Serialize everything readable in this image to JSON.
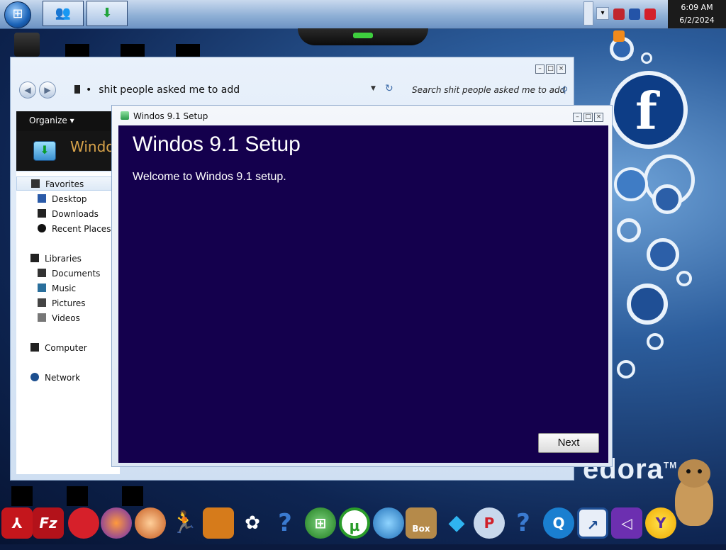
{
  "clock": {
    "time": "6:09 AM",
    "date": "6/2/2024"
  },
  "explorer": {
    "address": "shit people asked me to add",
    "search_placeholder": "Search shit people asked me to add",
    "organize_label": "Organize",
    "selected_item_name": "Windo",
    "nav": {
      "favorites": "Favorites",
      "desktop": "Desktop",
      "downloads": "Downloads",
      "recent_places": "Recent Places",
      "libraries": "Libraries",
      "documents": "Documents",
      "music": "Music",
      "pictures": "Pictures",
      "videos": "Videos",
      "computer": "Computer",
      "network": "Network"
    }
  },
  "setup": {
    "window_title": "Windos 9.1 Setup",
    "heading": "Windos 9.1 Setup",
    "welcome": "Welcome to Windos 9.1 setup.",
    "next_label": "Next"
  },
  "wallpaper": {
    "brand_text": "edora",
    "trademark": "TM"
  },
  "dock": {
    "icons": [
      "adobe-reader-icon",
      "filezilla-icon",
      "red-bird-icon",
      "firefox-icon",
      "melon-icon",
      "runner-icon",
      "archive-icon",
      "flower-icon",
      "help-icon",
      "windows-logo-icon",
      "utorrent-icon",
      "download-manager-icon",
      "box-icon",
      "gem-icon",
      "p-icon",
      "help-icon",
      "quicktime-icon",
      "arrow-icon",
      "visual-studio-icon",
      "yahoo-messenger-icon"
    ],
    "box_label": "Box"
  },
  "colors": {
    "setup_bg": "#14004d",
    "taskbar": "#8fb0d6"
  }
}
